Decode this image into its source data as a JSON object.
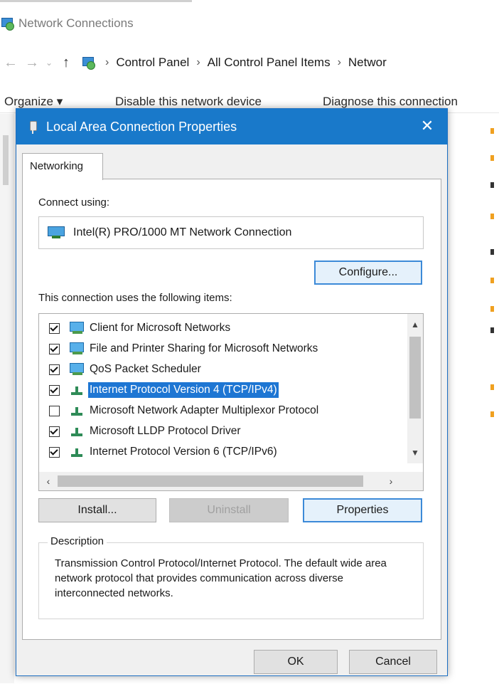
{
  "explorer": {
    "title": "Network Connections",
    "breadcrumbs": [
      "Control Panel",
      "All Control Panel Items",
      "Networ"
    ],
    "commands": [
      "Organize ▾",
      "Disable this network device",
      "Diagnose this connection"
    ]
  },
  "dialog": {
    "title": "Local Area Connection Properties",
    "close_glyph": "✕",
    "tab_label": "Networking",
    "connect_using_label": "Connect using:",
    "adapter_name": "Intel(R) PRO/1000 MT Network Connection",
    "configure_label": "Configure...",
    "items_label": "This connection uses the following items:",
    "items": [
      {
        "checked": true,
        "icon": "client-icon",
        "label": "Client for Microsoft Networks",
        "selected": false
      },
      {
        "checked": true,
        "icon": "client-icon",
        "label": "File and Printer Sharing for Microsoft Networks",
        "selected": false
      },
      {
        "checked": true,
        "icon": "client-icon",
        "label": "QoS Packet Scheduler",
        "selected": false
      },
      {
        "checked": true,
        "icon": "protocol-icon",
        "label": "Internet Protocol Version 4 (TCP/IPv4)",
        "selected": true
      },
      {
        "checked": false,
        "icon": "protocol-icon",
        "label": "Microsoft Network Adapter Multiplexor Protocol",
        "selected": false
      },
      {
        "checked": true,
        "icon": "protocol-icon",
        "label": "Microsoft LLDP Protocol Driver",
        "selected": false
      },
      {
        "checked": true,
        "icon": "protocol-icon",
        "label": "Internet Protocol Version 6 (TCP/IPv6)",
        "selected": false
      }
    ],
    "install_label": "Install...",
    "uninstall_label": "Uninstall",
    "properties_label": "Properties",
    "description_legend": "Description",
    "description_text": "Transmission Control Protocol/Internet Protocol. The default wide area network protocol that provides communication across diverse interconnected networks.",
    "ok_label": "OK",
    "cancel_label": "Cancel"
  },
  "colors": {
    "titlebar": "#1979ca",
    "selection": "#1e76d3",
    "primary_button_border": "#3c8ad8"
  }
}
